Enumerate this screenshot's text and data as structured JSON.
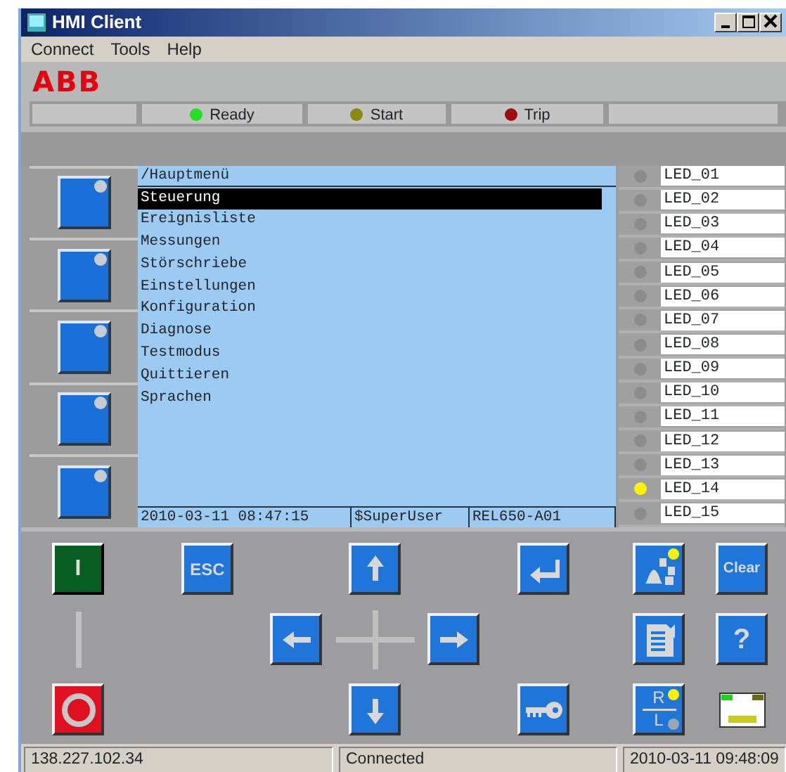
{
  "window": {
    "title": "HMI Client"
  },
  "menu_bar": [
    "Connect",
    "Tools",
    "Help"
  ],
  "logo": "ABB",
  "indicators": [
    {
      "label": "Ready",
      "color": "#22e022"
    },
    {
      "label": "Start",
      "color": "#8a8a10"
    },
    {
      "label": "Trip",
      "color": "#9a1010"
    }
  ],
  "function_keys": [
    {
      "indicator_lit": false
    },
    {
      "indicator_lit": false
    },
    {
      "indicator_lit": false
    },
    {
      "indicator_lit": false
    },
    {
      "indicator_lit": false
    }
  ],
  "display": {
    "path": "/Hauptmenü",
    "items": [
      {
        "label": "Steuerung",
        "selected": true
      },
      {
        "label": "Ereignisliste",
        "selected": false
      },
      {
        "label": "Messungen",
        "selected": false
      },
      {
        "label": "Störschriebe",
        "selected": false
      },
      {
        "label": "Einstellungen",
        "selected": false
      },
      {
        "label": "Konfiguration",
        "selected": false
      },
      {
        "label": "Diagnose",
        "selected": false
      },
      {
        "label": "Testmodus",
        "selected": false
      },
      {
        "label": "Quittieren",
        "selected": false
      },
      {
        "label": "Sprachen",
        "selected": false
      }
    ],
    "footer": [
      "2010-03-11 08:47:15",
      "$SuperUser",
      "REL650-A01"
    ]
  },
  "leds": [
    {
      "label": "LED_01",
      "lit": false
    },
    {
      "label": "LED_02",
      "lit": false
    },
    {
      "label": "LED_03",
      "lit": false
    },
    {
      "label": "LED_04",
      "lit": false
    },
    {
      "label": "LED_05",
      "lit": false
    },
    {
      "label": "LED_06",
      "lit": false
    },
    {
      "label": "LED_07",
      "lit": false
    },
    {
      "label": "LED_08",
      "lit": false
    },
    {
      "label": "LED_09",
      "lit": false
    },
    {
      "label": "LED_10",
      "lit": false
    },
    {
      "label": "LED_11",
      "lit": false
    },
    {
      "label": "LED_12",
      "lit": false
    },
    {
      "label": "LED_13",
      "lit": false
    },
    {
      "label": "LED_14",
      "lit": true
    },
    {
      "label": "LED_15",
      "lit": false
    }
  ],
  "keypad": [
    {
      "kind": "on",
      "text": "I"
    },
    {
      "kind": "esc",
      "text": "ESC"
    },
    {
      "kind": "up"
    },
    {
      "kind": "enter"
    },
    {
      "kind": "events",
      "indicator_lit": true
    },
    {
      "kind": "clear",
      "text": "Clear"
    },
    {
      "kind": "left"
    },
    {
      "kind": "right"
    },
    {
      "kind": "list"
    },
    {
      "kind": "help",
      "text": "?"
    },
    {
      "kind": "off"
    },
    {
      "kind": "down"
    },
    {
      "kind": "key"
    },
    {
      "kind": "local_remote",
      "top_text": "R",
      "bottom_text": "L",
      "top_lit": true,
      "bottom_lit": false
    },
    {
      "kind": "network"
    }
  ],
  "status_bar": [
    "138.227.102.34",
    "Connected",
    "2010-03-11 09:48:09"
  ]
}
